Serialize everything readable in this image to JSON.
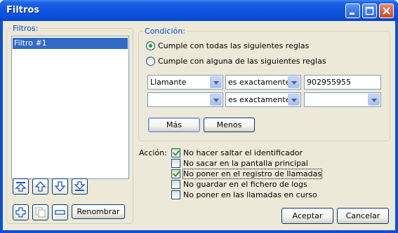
{
  "window": {
    "title": "Filtros",
    "minimize_icon": "minimize-icon",
    "maximize_icon": "maximize-icon",
    "close_icon": "close-icon"
  },
  "filters": {
    "legend": "Filtros:",
    "items": [
      "Filtro #1"
    ],
    "move_buttons": [
      "move-top-icon",
      "move-up-icon",
      "move-down-icon",
      "move-bottom-icon"
    ],
    "add_icon": "add-icon",
    "copy_icon": "copy-icon",
    "remove_icon": "remove-icon",
    "rename_label": "Renombrar"
  },
  "condition": {
    "legend": "Condición:",
    "match_all_label": "Cumple con todas las siguientes reglas",
    "match_any_label": "Cumple con alguna de las siguientes reglas",
    "selected_mode": "all",
    "rules": [
      {
        "field": "Llamante",
        "operator": "es exactamente",
        "value": "902955955"
      },
      {
        "field": "",
        "operator": "es exactamente",
        "value": ""
      }
    ],
    "more_label": "Más",
    "less_label": "Menos"
  },
  "action": {
    "label": "Acción:",
    "options": [
      {
        "label": "No hacer saltar el identificador",
        "checked": true
      },
      {
        "label": "No sacar en la pantalla principal",
        "checked": false
      },
      {
        "label": "No poner en el registro de llamadas",
        "checked": true
      },
      {
        "label": "No guardar en el fichero de logs",
        "checked": false
      },
      {
        "label": "No poner en las llamadas en curso",
        "checked": false
      }
    ]
  },
  "footer": {
    "accept_label": "Aceptar",
    "cancel_label": "Cancelar"
  },
  "colors": {
    "titlebar": "#0a4fd6",
    "dialog_bg": "#ece9d8",
    "legend_text": "#0046d5",
    "selection": "#316ac5",
    "check_mark": "#21a121"
  }
}
